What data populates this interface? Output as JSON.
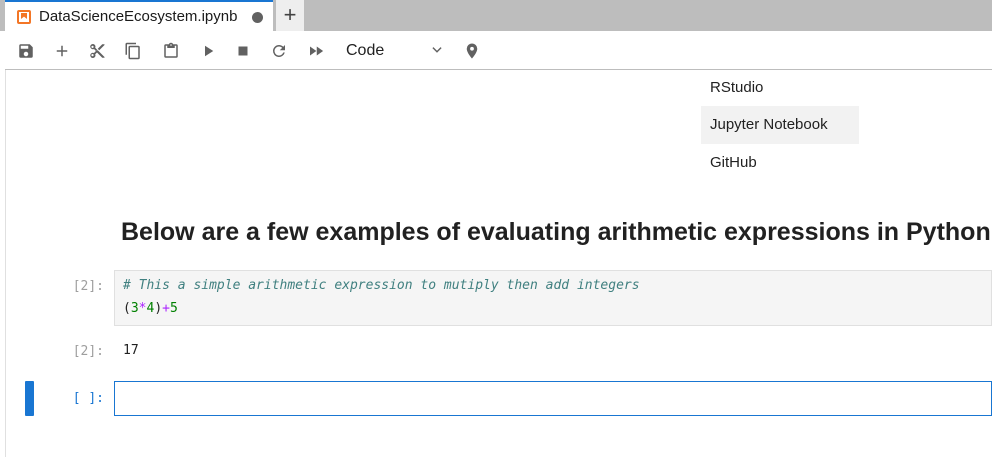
{
  "tab": {
    "title": "DataScienceEcosystem.ipynb",
    "icon": "notebook-icon",
    "dirty_indicator": "unsaved-dot-icon",
    "new_tab": "+"
  },
  "toolbar": {
    "buttons": [
      {
        "name": "save-icon"
      },
      {
        "name": "add-cell-icon"
      },
      {
        "name": "cut-icon"
      },
      {
        "name": "copy-icon"
      },
      {
        "name": "paste-icon"
      },
      {
        "name": "run-icon"
      },
      {
        "name": "stop-icon"
      },
      {
        "name": "restart-icon"
      },
      {
        "name": "fast-forward-icon"
      }
    ],
    "cell_type": "Code",
    "pin_icon": "location-pin-icon"
  },
  "notebook": {
    "list_items": [
      "RStudio",
      "Jupyter Notebook",
      "GitHub"
    ],
    "heading": "Below are a few examples of evaluating arithmetic expressions in Python",
    "code_cell": {
      "prompt": "[2]:",
      "comment": "# This a simple arithmetic expression to mutiply then add integers",
      "code_paren_open": "(",
      "code_a": "3",
      "code_mul": "*",
      "code_b": "4",
      "code_paren_close": ")",
      "code_plus": "+",
      "code_c": "5"
    },
    "output_cell": {
      "prompt": "[2]:",
      "text": "17"
    },
    "empty_cell": {
      "prompt": "[ ]:"
    }
  },
  "colors": {
    "accent": "#1976d2",
    "jupyter_orange": "#f37626"
  }
}
